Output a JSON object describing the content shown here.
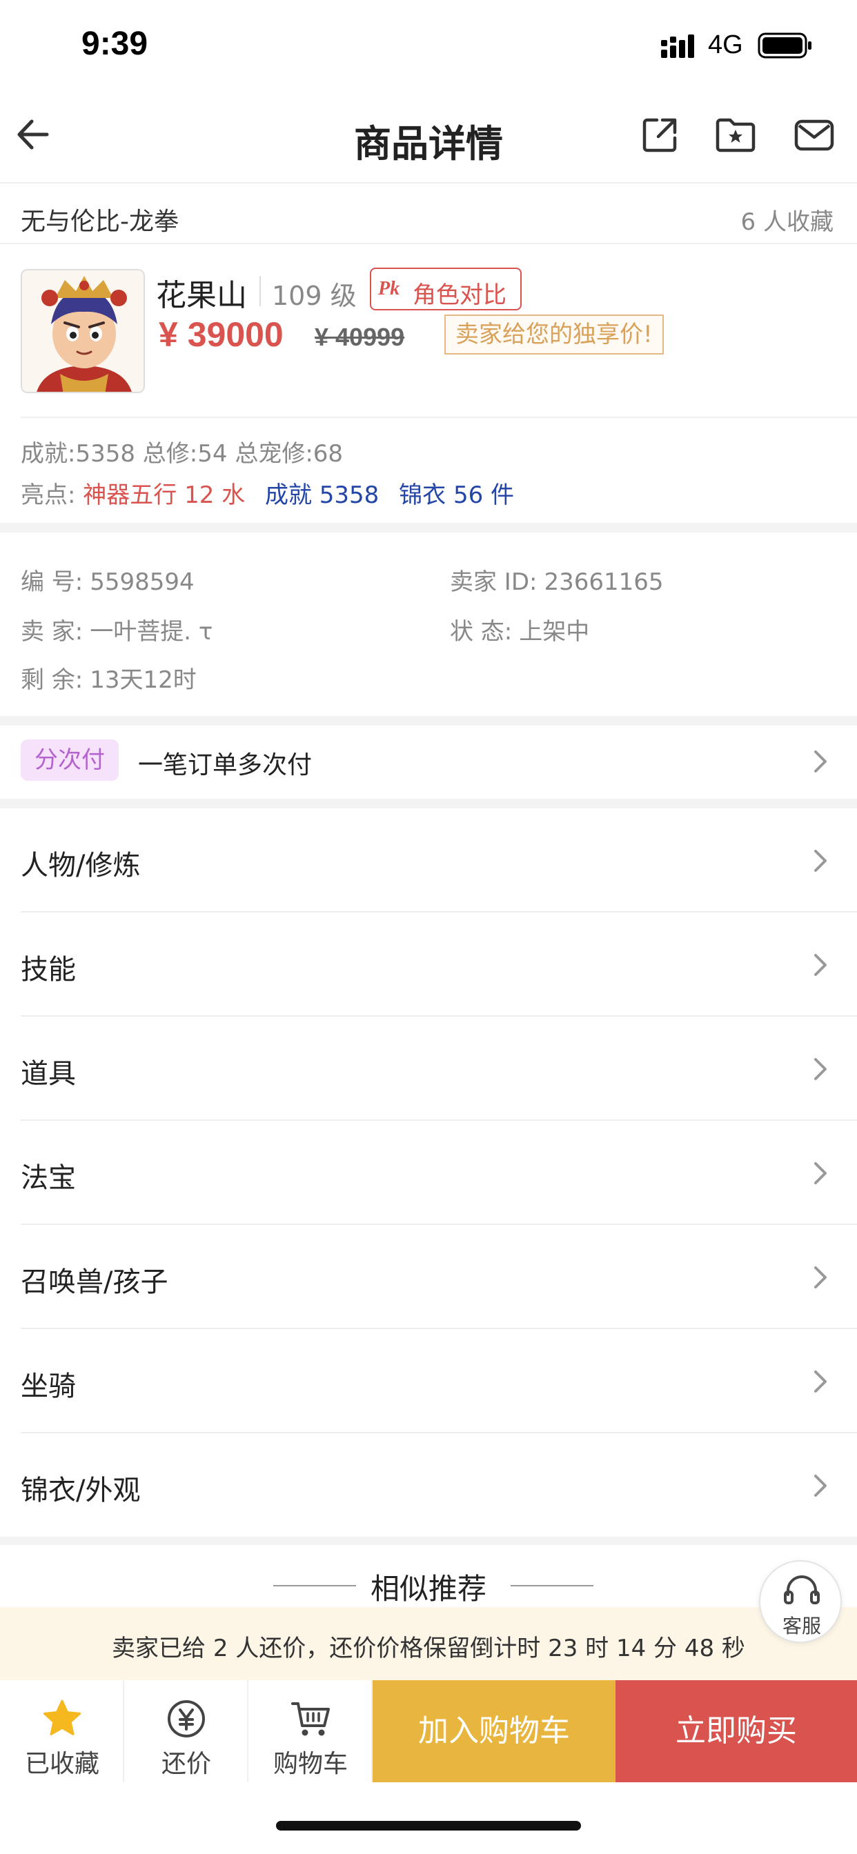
{
  "status_bar": {
    "time": "9:39",
    "network": "4G"
  },
  "nav": {
    "title": "商品详情",
    "icons": [
      "back-arrow-icon",
      "share-icon",
      "favorite-folder-icon",
      "message-icon"
    ]
  },
  "header": {
    "title": "无与伦比-龙拳",
    "favorites": "6 人收藏"
  },
  "role": {
    "name": "花果山",
    "level": "109 级",
    "pk_icon": "Pk",
    "pk_label": "角色对比",
    "price": "¥ 39000",
    "old_price": "¥ 40999",
    "exclusive": "卖家给您的独享价!"
  },
  "stats": "成就:5358 总修:54 总宠修:68",
  "highlights": {
    "label": "亮点:",
    "red": "神器五行 12 水",
    "blue1": "成就 5358",
    "blue2": "锦衣 56 件"
  },
  "info": {
    "id_label": "编 号:",
    "id_value": "5598594",
    "seller_id_label": "卖家 ID:",
    "seller_id_value": "23661165",
    "seller_label": "卖 家:",
    "seller_value": "一叶菩提. τ",
    "status_label": "状 态:",
    "status_value": "上架中",
    "remain_label": "剩 余:",
    "remain_value": "13天12时"
  },
  "installment": {
    "tag": "分次付",
    "text": "一笔订单多次付"
  },
  "menu": [
    "人物/修炼",
    "技能",
    "道具",
    "法宝",
    "召唤兽/孩子",
    "坐骑",
    "锦衣/外观"
  ],
  "recommend": {
    "title": "相似推荐"
  },
  "service": {
    "label": "客服"
  },
  "notice": "卖家已给 2 人还价，还价价格保留倒计时 23 时 14 分 48 秒",
  "bottom": {
    "favorited": "已收藏",
    "bargain": "还价",
    "cart": "购物车",
    "add_cart": "加入购物车",
    "buy_now": "立即购买"
  },
  "colors": {
    "price_red": "#d9534f",
    "cart_yellow": "#e8b53f",
    "buy_red": "#d9534f",
    "link_blue": "#2345a7",
    "installment_purple": "#b463cf"
  }
}
